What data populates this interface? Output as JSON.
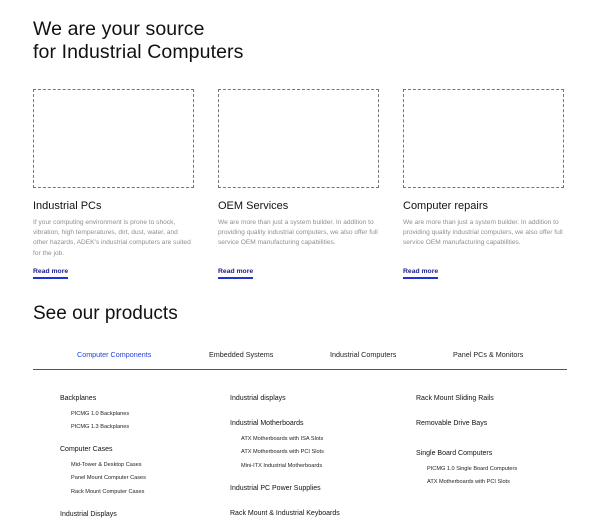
{
  "hero": {
    "line1": "We are your source",
    "line2": "for Industrial Computers"
  },
  "cards": [
    {
      "title": "Industrial PCs",
      "description": "If your computing environment is prone to shock, vibration, high temperatures, dirt, dust, water, and other hazards, ADEK's industrial computers are suited for the job.",
      "link": "Read more"
    },
    {
      "title": "OEM Services",
      "description": "We are more than just a system builder. In addition to providing quality industrial computers, we also offer full service OEM manufacturing capabilities.",
      "link": "Read more"
    },
    {
      "title": "Computer repairs",
      "description": "We are more than just a system builder. In addition to providing quality industrial computers, we also offer full service OEM manufacturing capabilities.",
      "link": "Read more"
    }
  ],
  "products": {
    "title": "See our products",
    "tabs": [
      "Computer Components",
      "Embedded Systems",
      "Industrial Computers",
      "Panel PCs & Monitors"
    ],
    "active_tab": 0,
    "columns": [
      [
        {
          "label": "Backplanes",
          "items": [
            "PICMG 1.0 Backplanes",
            "PICMG 1.3 Backplanes"
          ]
        },
        {
          "label": "Computer Cases",
          "items": [
            "Mid-Tower & Desktop Cases",
            "Panel Mount Computer Cases",
            "Rack Mount Computer Cases"
          ]
        },
        {
          "label": "Industrial Displays",
          "items": []
        }
      ],
      [
        {
          "label": "Industrial displays",
          "items": []
        },
        {
          "label": "Industrial Motherboards",
          "items": [
            "ATX Motherboards with ISA Slots",
            "ATX Motherboards with PCI Slots",
            "Mini-ITX Industrial Motherboards"
          ]
        },
        {
          "label": "Industrial PC Power Supplies",
          "items": []
        },
        {
          "label": "Rack Mount & Industrial Keyboards",
          "items": []
        }
      ],
      [
        {
          "label": "Rack Mount Sliding Rails",
          "items": []
        },
        {
          "label": "Removable Drive Bays",
          "items": []
        },
        {
          "label": "Single Board Computers",
          "items": [
            "PICMG 1.0 Single Board Computers",
            "ATX Motherboards with PCI Slots"
          ]
        }
      ]
    ]
  },
  "colors": {
    "accent": "#2642d8",
    "link_underline": "#2233d6",
    "muted_text": "#8f8f8f"
  }
}
